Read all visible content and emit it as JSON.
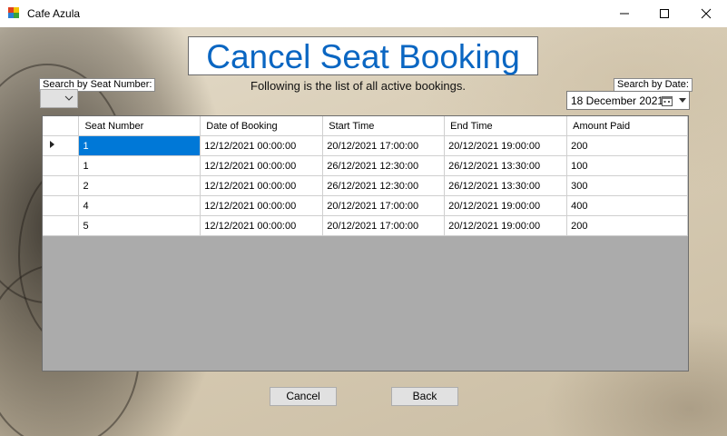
{
  "window": {
    "title": "Cafe Azula",
    "controls": [
      "minimize",
      "maximize",
      "close"
    ]
  },
  "form": {
    "heading": "Cancel Seat Booking",
    "subtitle": "Following is the list of all active bookings.",
    "search_seat_label": "Search by Seat Number:",
    "search_seat_value": "",
    "search_date_label": "Search by Date:",
    "search_date_value": "18 December 2021"
  },
  "grid": {
    "columns": [
      "Seat Number",
      "Date of Booking",
      "Start Time",
      "End Time",
      "Amount Paid"
    ],
    "rows": [
      [
        "1",
        "12/12/2021 00:00:00",
        "20/12/2021 17:00:00",
        "20/12/2021 19:00:00",
        "200"
      ],
      [
        "1",
        "12/12/2021 00:00:00",
        "26/12/2021 12:30:00",
        "26/12/2021 13:30:00",
        "100"
      ],
      [
        "2",
        "12/12/2021 00:00:00",
        "26/12/2021 12:30:00",
        "26/12/2021 13:30:00",
        "300"
      ],
      [
        "4",
        "12/12/2021 00:00:00",
        "20/12/2021 17:00:00",
        "20/12/2021 19:00:00",
        "400"
      ],
      [
        "5",
        "12/12/2021 00:00:00",
        "20/12/2021 17:00:00",
        "20/12/2021 19:00:00",
        "200"
      ]
    ],
    "selected_row": 0
  },
  "buttons": {
    "cancel": "Cancel",
    "back": "Back"
  },
  "colors": {
    "accent": "#0a66c2",
    "selection": "#0078d7",
    "grid_background": "#ababab"
  },
  "icons": {
    "app": "cafe-app-icon",
    "calendar": "calendar-icon",
    "row_pointer": "current-row-icon"
  }
}
